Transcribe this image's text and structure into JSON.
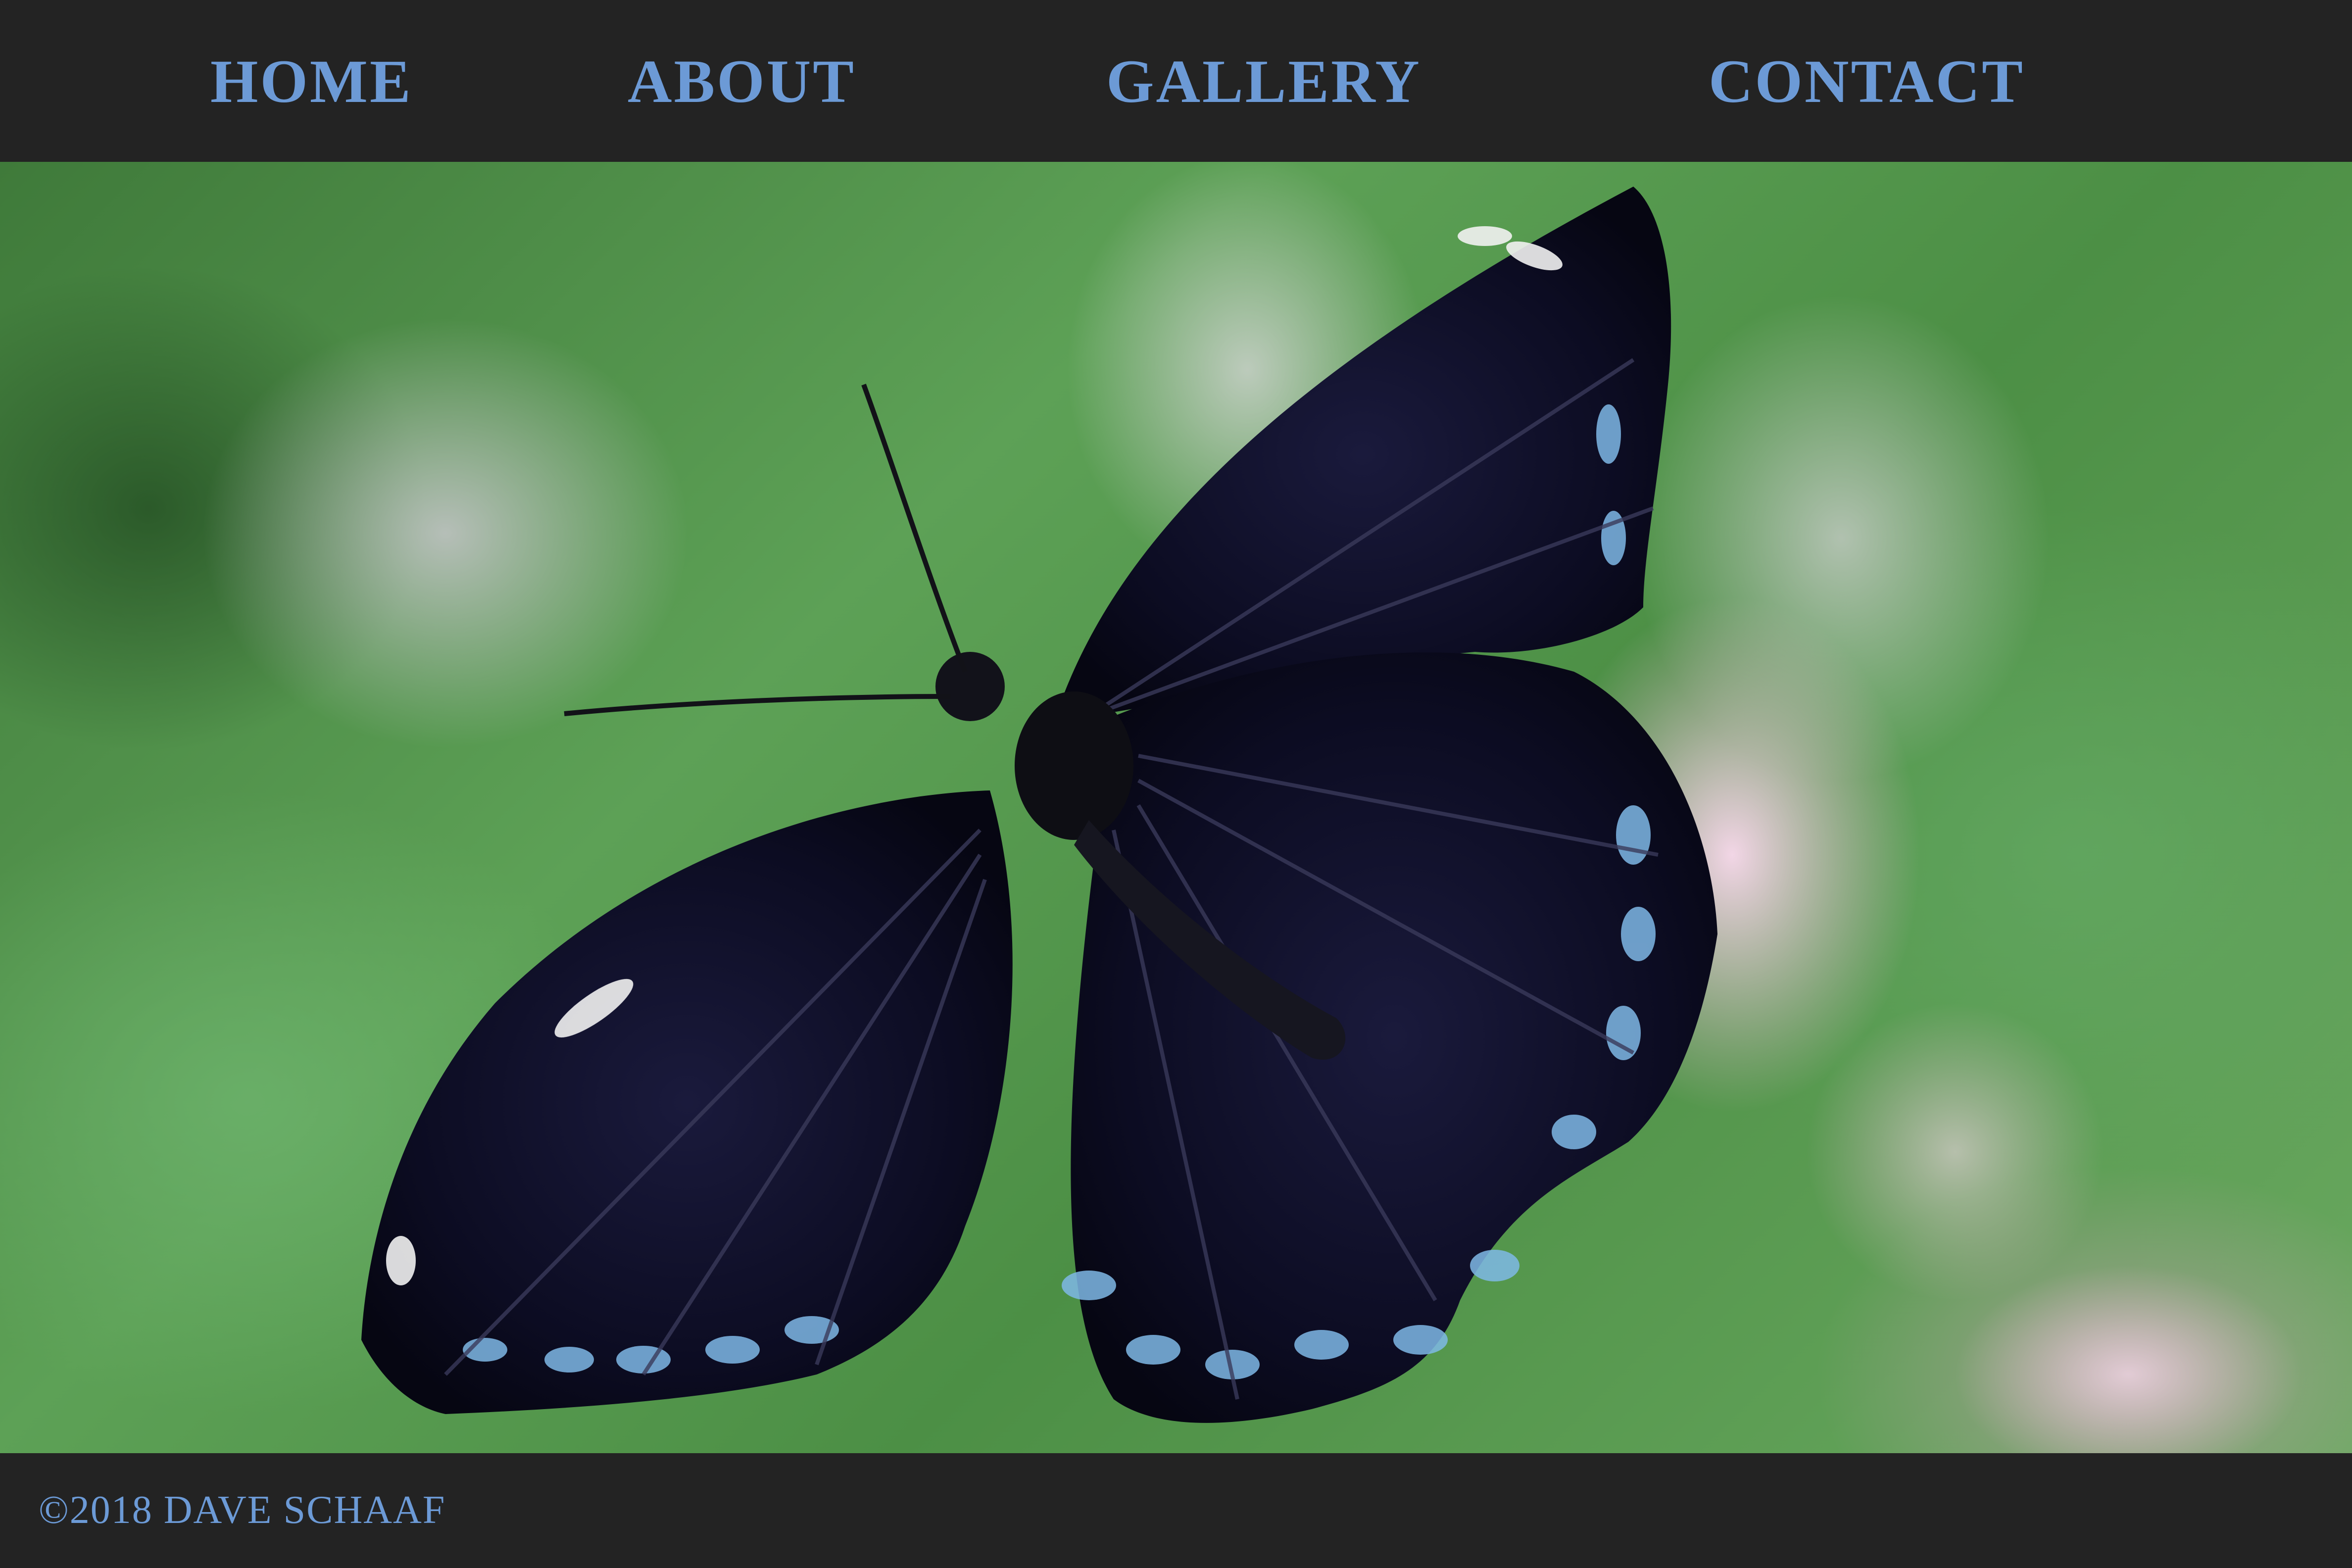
{
  "nav": {
    "items": [
      {
        "label": "HOME"
      },
      {
        "label": "ABOUT"
      },
      {
        "label": "GALLERY"
      },
      {
        "label": "CONTACT"
      }
    ]
  },
  "footer": {
    "copyright": "©2018  DAVE SCHAAF"
  },
  "colors": {
    "nav_background": "#232323",
    "link_color": "#6c9ad6"
  }
}
